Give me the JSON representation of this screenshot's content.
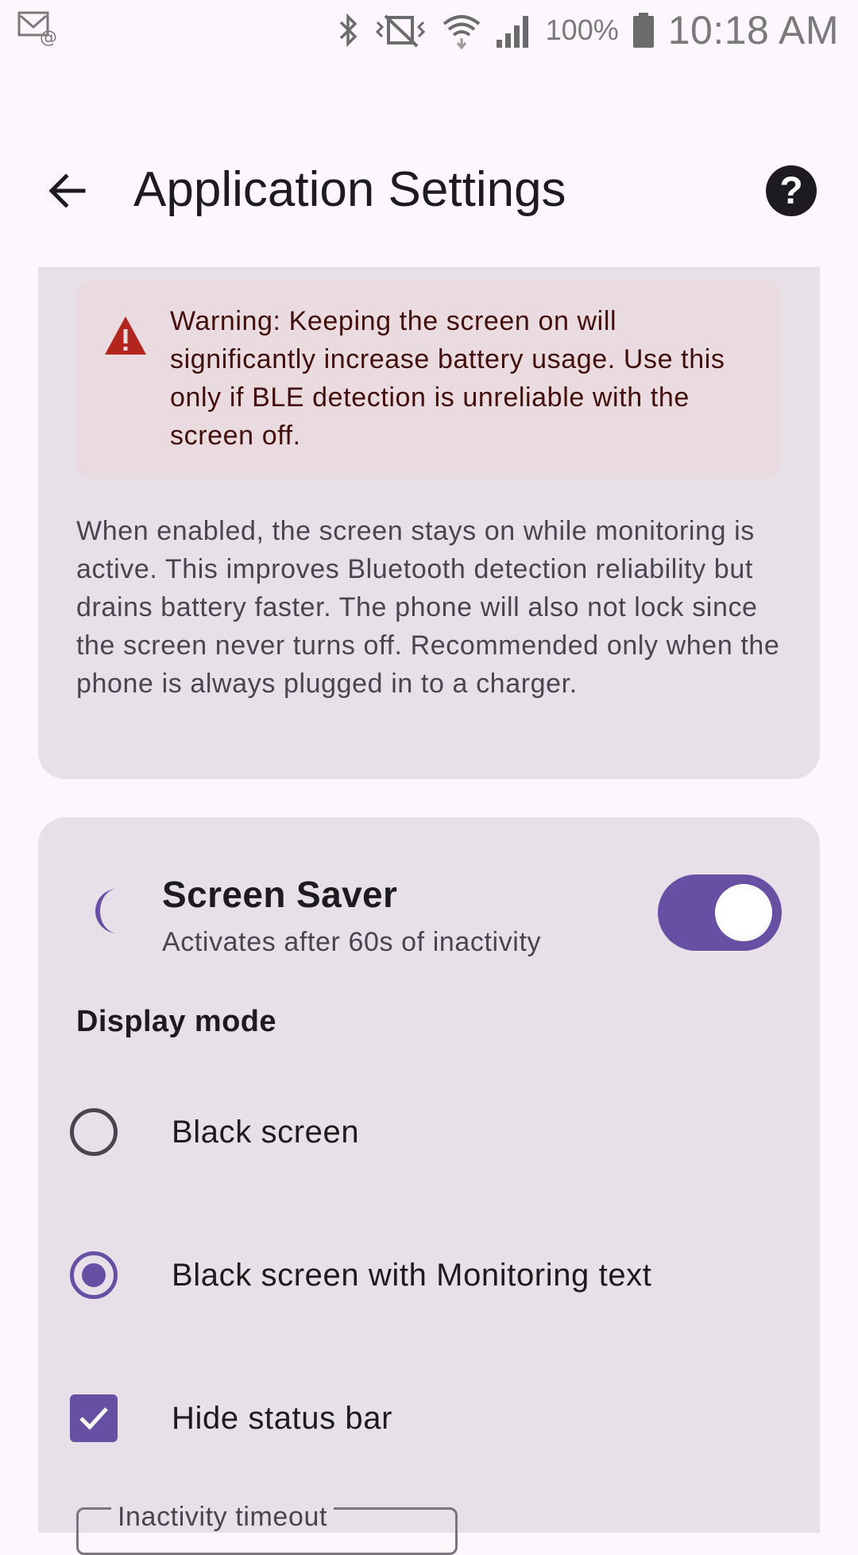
{
  "status_bar": {
    "battery_text": "100%",
    "time": "10:18 AM",
    "icons": [
      "notification-mail-icon",
      "bluetooth-icon",
      "vibrate-mute-icon",
      "wifi-icon",
      "cellular-signal-icon",
      "battery-icon"
    ]
  },
  "app_bar": {
    "title": "Application Settings",
    "help_glyph": "?"
  },
  "keep_screen_on": {
    "warning_text": "Warning: Keeping the screen on will significantly increase battery usage. Use this only if BLE detection is unreliable with the screen off.",
    "description": "When enabled, the screen stays on while monitoring is active. This improves Bluetooth detection reliability but drains battery faster. The phone will also not lock since the screen never turns off. Recommended only when the phone is always plugged in to a charger."
  },
  "screen_saver": {
    "title": "Screen Saver",
    "subtitle": "Activates after 60s of inactivity",
    "enabled": true,
    "display_mode_label": "Display mode",
    "options": [
      {
        "label": "Black screen",
        "selected": false
      },
      {
        "label": "Black screen with Monitoring text",
        "selected": true
      }
    ],
    "hide_status_bar": {
      "label": "Hide status bar",
      "checked": true
    },
    "inactivity_timeout_label": "Inactivity timeout"
  },
  "colors": {
    "accent": "#6750a4",
    "warning_icon": "#b3261e",
    "background": "#fdf7fd",
    "card": "#e7e0e8"
  }
}
